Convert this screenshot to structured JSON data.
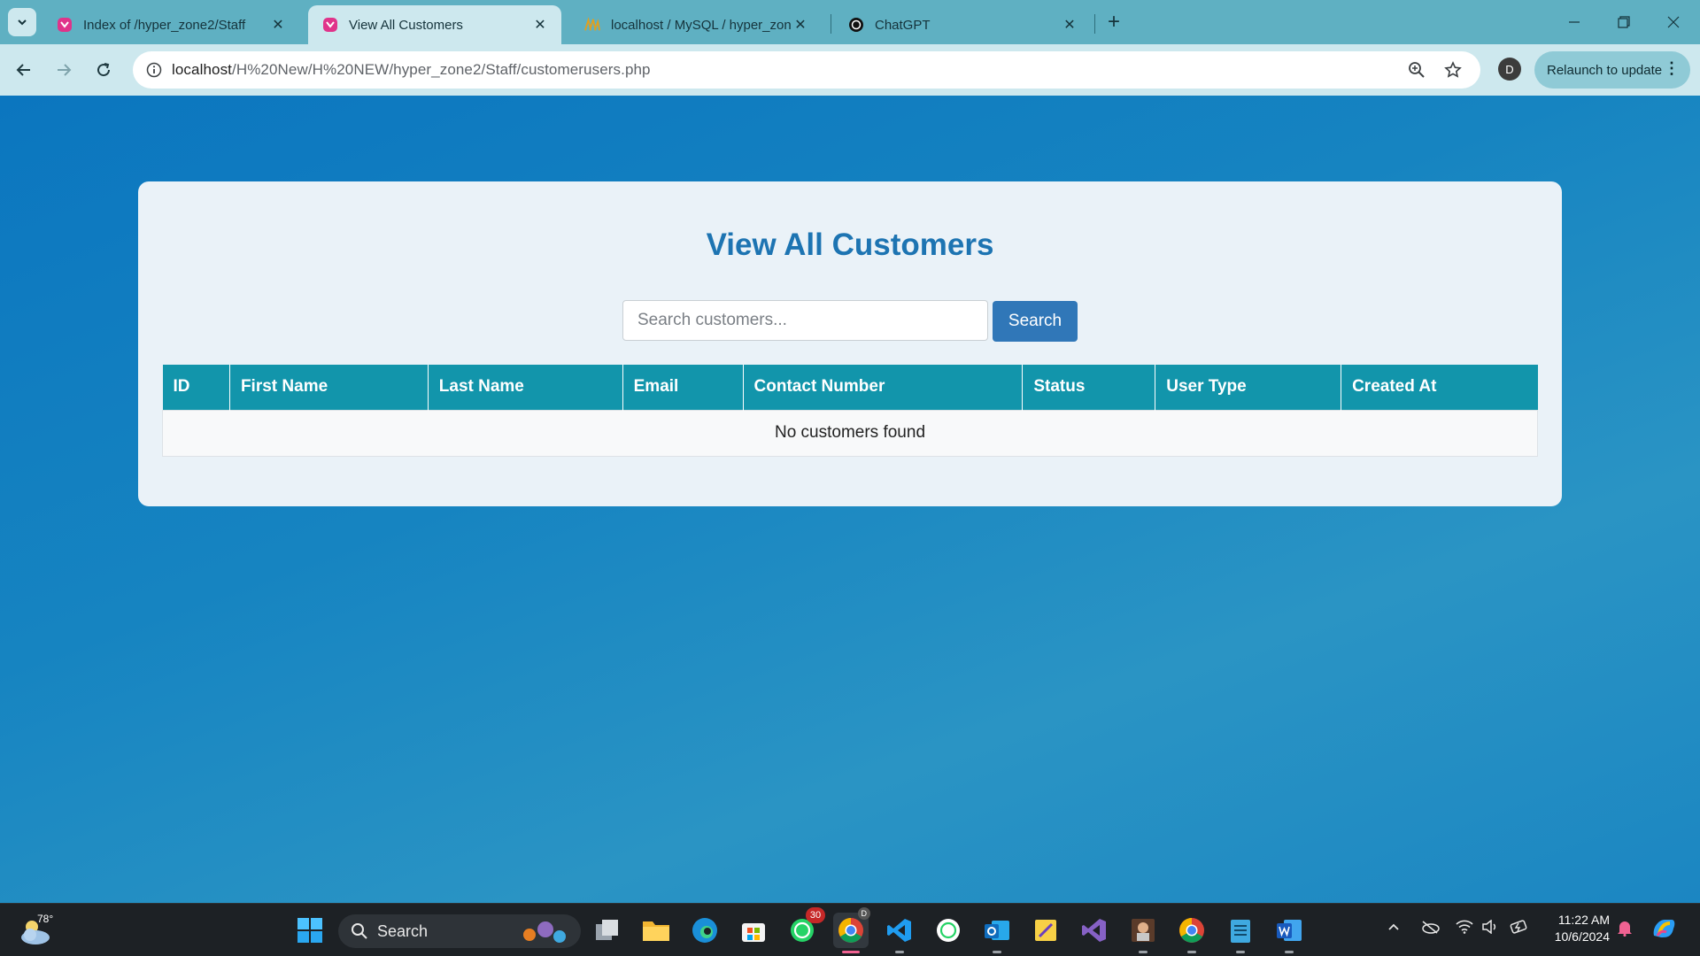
{
  "browser": {
    "tabs": [
      {
        "title": "Index of /hyper_zone2/Staff",
        "icon": "xampp-icon",
        "active": false
      },
      {
        "title": "View All Customers",
        "icon": "xampp-icon",
        "active": true
      },
      {
        "title": "localhost / MySQL / hyper_zone",
        "icon": "phpmyadmin-icon",
        "active": false
      },
      {
        "title": "ChatGPT",
        "icon": "chatgpt-icon",
        "active": false
      }
    ],
    "url_host": "localhost",
    "url_path": "/H%20New/H%20NEW/hyper_zone2/Staff/customerusers.php",
    "profile_initial": "D",
    "relaunch_label": "Relaunch to update"
  },
  "page": {
    "title": "View All Customers",
    "search": {
      "placeholder": "Search customers...",
      "value": "",
      "button_label": "Search"
    },
    "table": {
      "columns": [
        "ID",
        "First Name",
        "Last Name",
        "Email",
        "Contact Number",
        "Status",
        "User Type",
        "Created At"
      ],
      "empty_message": "No customers found"
    }
  },
  "taskbar": {
    "weather_temp": "78°",
    "search_label": "Search",
    "whatsapp_badge": "30",
    "chrome_profile_initial": "D",
    "time": "11:22 AM",
    "date": "10/6/2024"
  },
  "colors": {
    "page_background": "#1a86c4",
    "card_background": "#eaf2f8",
    "title_color": "#1d74b2",
    "table_header": "#1295ab",
    "search_button": "#3077b8"
  }
}
